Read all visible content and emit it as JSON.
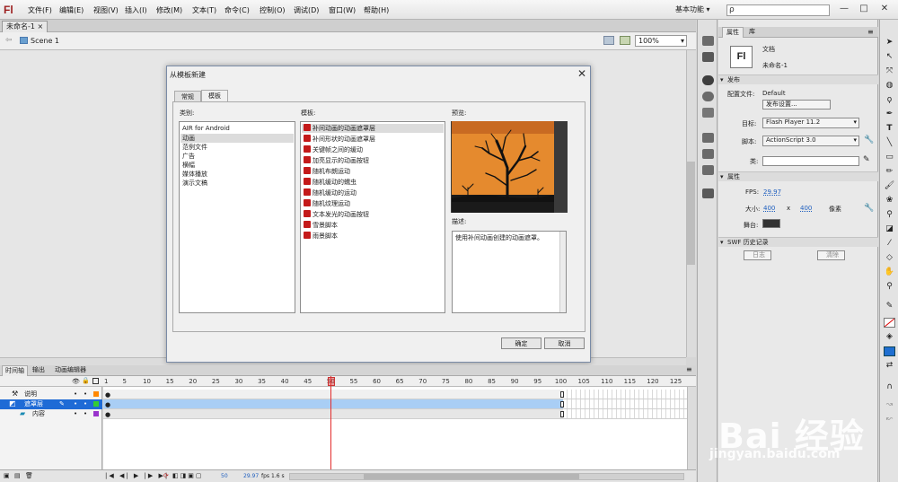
{
  "app": {
    "logo": "Fl",
    "workspace": "基本功能",
    "search_placeholder": "ρ"
  },
  "menu": [
    "文件(F)",
    "编辑(E)",
    "视图(V)",
    "插入(I)",
    "修改(M)",
    "文本(T)",
    "命令(C)",
    "控制(O)",
    "调试(D)",
    "窗口(W)",
    "帮助(H)"
  ],
  "window_controls": [
    "—",
    "□",
    "✕"
  ],
  "document": {
    "tab": "未命名-1",
    "tab_close": "×",
    "scene": "Scene 1",
    "zoom": "100%"
  },
  "dialog": {
    "title": "从模板新建",
    "close": "✕",
    "tabs": [
      "常规",
      "模板"
    ],
    "active_tab": "模板",
    "category_label": "类别:",
    "categories": [
      "AIR for Android",
      "动画",
      "范例文件",
      "广告",
      "横幅",
      "媒体播放",
      "演示文稿"
    ],
    "selected_category": "动画",
    "template_label": "模板:",
    "templates": [
      "补间动画的动画遮罩层",
      "补间形状的动画遮罩层",
      "关键帧之间的缓动",
      "加亮显示的动画按钮",
      "随机布朗运动",
      "随机缓动的蠕虫",
      "随机缓动的运动",
      "随机纹理运动",
      "文本发光的动画按钮",
      "雪景脚本",
      "雨景脚本"
    ],
    "selected_template": "补间动画的动画遮罩层",
    "preview_label": "预览:",
    "description_label": "描述:",
    "description": "使用补间动画创建的动画遮罩。",
    "ok": "确定",
    "cancel": "取消"
  },
  "properties": {
    "tabs": [
      "属性",
      "库"
    ],
    "doc_icon": "Fl",
    "doc_type": "文档",
    "doc_name": "未命名-1",
    "publish_section": "发布",
    "profile_label": "配置文件:",
    "profile_value": "Default",
    "publish_settings": "发布设置...",
    "target_label": "目标:",
    "target_value": "Flash Player 11.2",
    "script_label": "脚本:",
    "script_value": "ActionScript 3.0",
    "class_label": "类:",
    "attributes_section": "属性",
    "fps_label": "FPS:",
    "fps_value": "29.97",
    "size_label": "大小:",
    "width_value": "400",
    "x_label": "x",
    "height_value": "400",
    "units": "像素",
    "stage_label": "舞台:",
    "stage_color": "#333333",
    "swf_section": "SWF 历史记录",
    "log_button": "日志",
    "clear_button": "清除"
  },
  "timeline": {
    "tabs": [
      "时间轴",
      "输出",
      "动画编辑器"
    ],
    "frame_ticks": [
      "1",
      "5",
      "10",
      "15",
      "20",
      "25",
      "30",
      "35",
      "40",
      "45",
      "50",
      "55",
      "60",
      "65",
      "70",
      "75",
      "80",
      "85",
      "90",
      "95",
      "100",
      "105",
      "110",
      "115",
      "120",
      "125"
    ],
    "layers": [
      {
        "name": "说明",
        "color": "#ff8800",
        "selected": false
      },
      {
        "name": "遮罩层",
        "color": "#33cc33",
        "selected": true
      },
      {
        "name": "内容",
        "color": "#9933cc",
        "selected": false
      }
    ],
    "current_frame": "50",
    "fps": "29.97",
    "fps_unit": "fps",
    "time": "1.6 s"
  },
  "watermark": {
    "brand": "Bai  经验",
    "url": "jingyan.baidu.com"
  }
}
